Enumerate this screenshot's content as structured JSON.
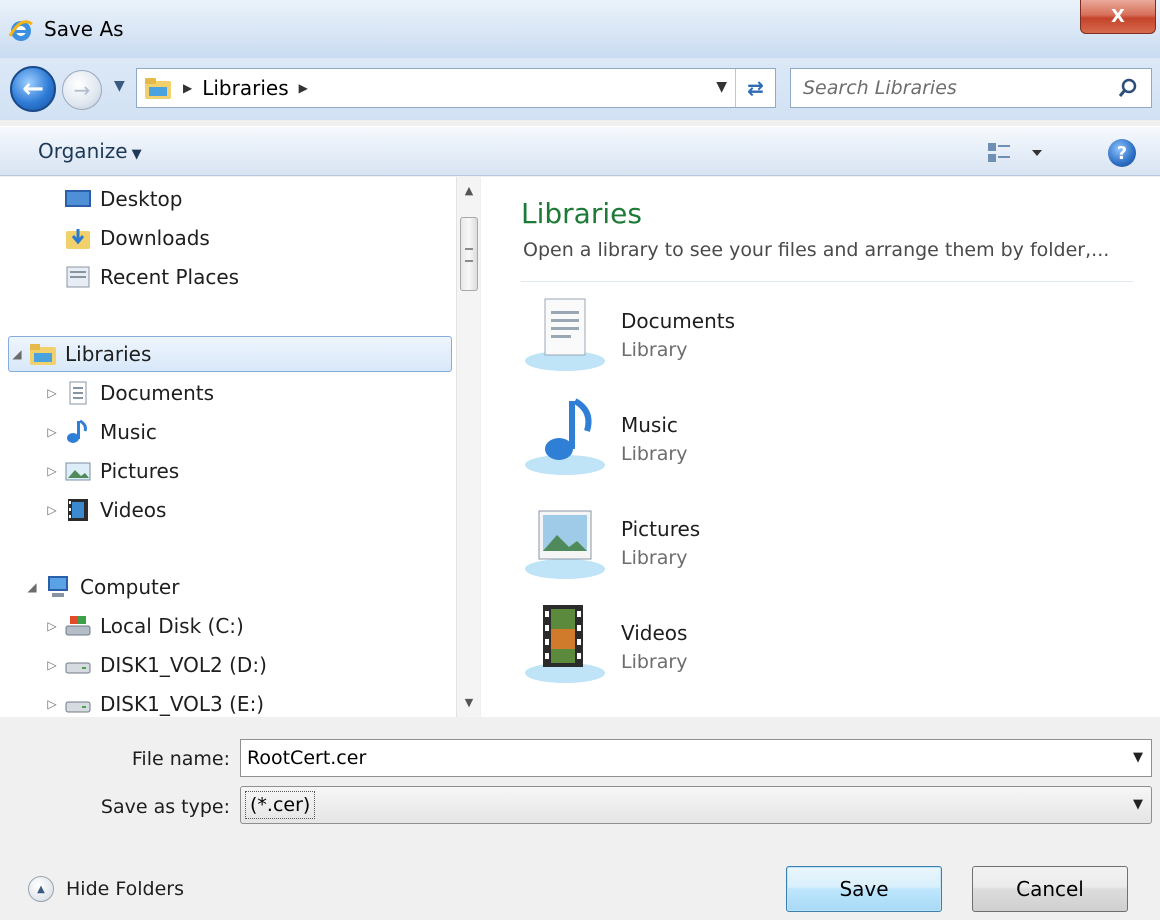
{
  "window": {
    "title": "Save As",
    "close_label": "X"
  },
  "address": {
    "path": "Libraries",
    "search_placeholder": "Search Libraries"
  },
  "toolbar": {
    "organize_label": "Organize"
  },
  "nav_tree": {
    "favorites": [
      {
        "label": "Desktop",
        "icon": "desktop-icon"
      },
      {
        "label": "Downloads",
        "icon": "downloads-icon"
      },
      {
        "label": "Recent Places",
        "icon": "recent-places-icon"
      }
    ],
    "libraries": {
      "label": "Libraries",
      "children": [
        {
          "label": "Documents",
          "icon": "documents-icon"
        },
        {
          "label": "Music",
          "icon": "music-icon"
        },
        {
          "label": "Pictures",
          "icon": "pictures-icon"
        },
        {
          "label": "Videos",
          "icon": "videos-icon"
        }
      ]
    },
    "computer": {
      "label": "Computer",
      "children": [
        {
          "label": "Local Disk (C:)",
          "icon": "local-disk-icon"
        },
        {
          "label": "DISK1_VOL2 (D:)",
          "icon": "drive-icon"
        },
        {
          "label": "DISK1_VOL3 (E:)",
          "icon": "drive-icon"
        }
      ]
    }
  },
  "content": {
    "title": "Libraries",
    "subtitle": "Open a library to see your files and arrange them by folder,...",
    "items": [
      {
        "name": "Documents",
        "type": "Library"
      },
      {
        "name": "Music",
        "type": "Library"
      },
      {
        "name": "Pictures",
        "type": "Library"
      },
      {
        "name": "Videos",
        "type": "Library"
      }
    ]
  },
  "form": {
    "file_name_label": "File name:",
    "file_name_value": "RootCert.cer",
    "save_type_label": "Save as type:",
    "save_type_value": "(*.cer)"
  },
  "footer": {
    "hide_folders_label": "Hide Folders",
    "save_label": "Save",
    "cancel_label": "Cancel"
  },
  "colors": {
    "library_title": "#1e7a37",
    "selection_border": "#84acdd"
  }
}
